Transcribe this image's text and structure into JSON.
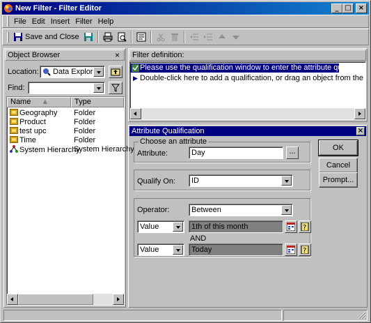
{
  "window": {
    "title": "New Filter - Filter Editor",
    "minimize": "_",
    "maximize": "□",
    "close": "×"
  },
  "menu": [
    "File",
    "Edit",
    "Insert",
    "Filter",
    "Help"
  ],
  "toolbar": {
    "save_close": "Save and Close"
  },
  "object_browser": {
    "title": "Object Browser",
    "close": "×",
    "location_label": "Location:",
    "location_value": "Data Explorer",
    "find_label": "Find:",
    "find_value": "",
    "columns": [
      "Name",
      "Type"
    ],
    "items": [
      {
        "name": "Geography",
        "type": "Folder",
        "icon": "folder-icon"
      },
      {
        "name": "Product",
        "type": "Folder",
        "icon": "folder-icon"
      },
      {
        "name": "test upc",
        "type": "Folder",
        "icon": "folder-icon"
      },
      {
        "name": "Time",
        "type": "Folder",
        "icon": "folder-icon"
      },
      {
        "name": "System Hierarchy",
        "type": "System Hierarchy",
        "icon": "hierarchy-icon"
      }
    ]
  },
  "filter_definition": {
    "title": "Filter definition:",
    "line1": "Please use the qualification window to enter the attribute qualification.",
    "line2": "Double-click here to add a qualification, or drag an object from the object browse"
  },
  "attribute_qualification": {
    "title": "Attribute Qualification",
    "close": "×",
    "group_choose": "Choose an attribute",
    "attribute_label": "Attribute:",
    "attribute_value": "Day",
    "browse_label": "...",
    "qualify_label": "Qualify On:",
    "qualify_value": "ID",
    "operator_label": "Operator:",
    "operator_value": "Between",
    "value1_type": "Value",
    "value1": "1th of this month",
    "and_label": "AND",
    "value2_type": "Value",
    "value2": "Today",
    "ok": "OK",
    "cancel": "Cancel",
    "prompt": "Prompt..."
  },
  "colors": {
    "title_active": "#000080",
    "selection": "#000080",
    "face": "#c0c0c0"
  }
}
